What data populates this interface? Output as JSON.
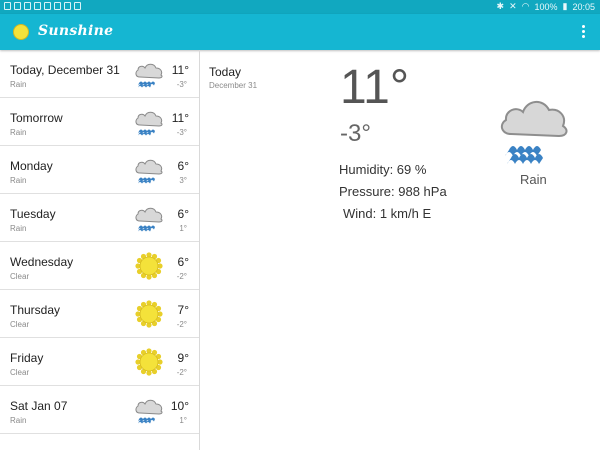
{
  "status_bar": {
    "battery": "100%",
    "time": "20:05"
  },
  "app": {
    "title": "Sunshine"
  },
  "colors": {
    "appbar": "#15b6d2",
    "statusbar": "#11a8c0",
    "sun": "#f2df33",
    "rain": "#3d86c6",
    "cloud": "#d8d8d8"
  },
  "forecast": [
    {
      "day": "Today, December 31",
      "desc": "Rain",
      "high": "11°",
      "low": "-3°",
      "icon": "rain-icon"
    },
    {
      "day": "Tomorrow",
      "desc": "Rain",
      "high": "11°",
      "low": "-3°",
      "icon": "rain-icon"
    },
    {
      "day": "Monday",
      "desc": "Rain",
      "high": "6°",
      "low": "3°",
      "icon": "rain-icon"
    },
    {
      "day": "Tuesday",
      "desc": "Rain",
      "high": "6°",
      "low": "1°",
      "icon": "rain-icon"
    },
    {
      "day": "Wednesday",
      "desc": "Clear",
      "high": "6°",
      "low": "-2°",
      "icon": "sun-icon"
    },
    {
      "day": "Thursday",
      "desc": "Clear",
      "high": "7°",
      "low": "-2°",
      "icon": "sun-icon"
    },
    {
      "day": "Friday",
      "desc": "Clear",
      "high": "9°",
      "low": "-2°",
      "icon": "sun-icon"
    },
    {
      "day": "Sat Jan 07",
      "desc": "Rain",
      "high": "10°",
      "low": "1°",
      "icon": "rain-icon"
    }
  ],
  "detail": {
    "day": "Today",
    "date": "December 31",
    "high": "11°",
    "low": "-3°",
    "humidity": "Humidity: 69 %",
    "pressure": "Pressure: 988 hPa",
    "wind": "Wind: 1 km/h E",
    "desc": "Rain",
    "icon": "rain-icon"
  }
}
